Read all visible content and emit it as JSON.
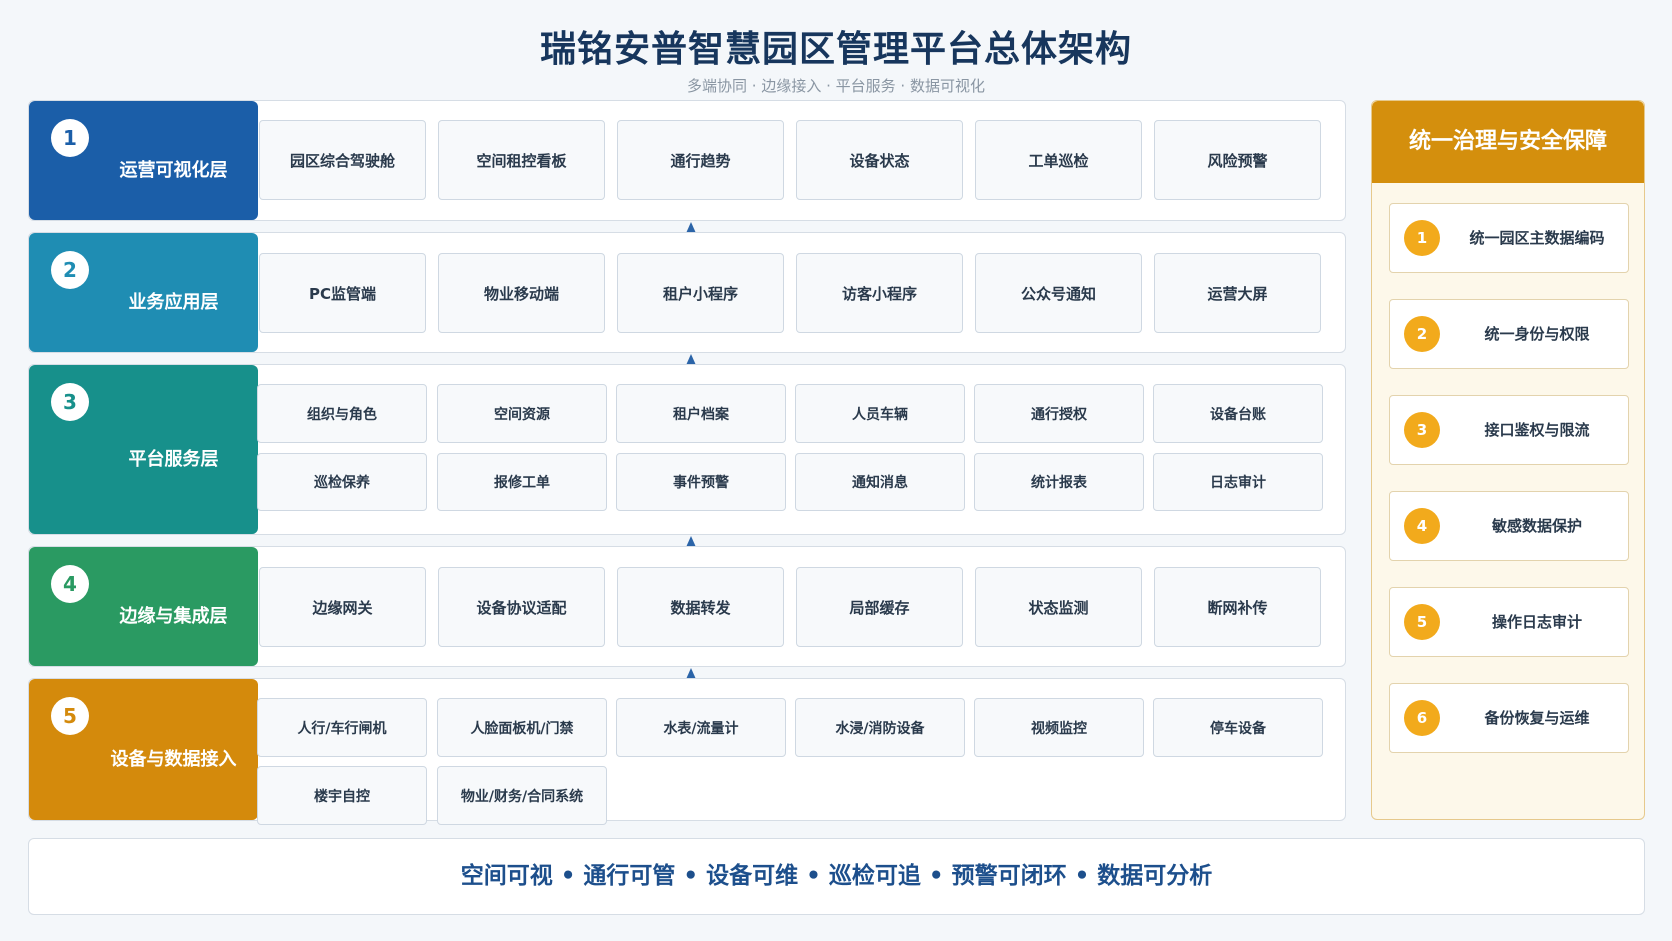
{
  "title": "瑞铭安普智慧园区管理平台总体架构",
  "subtitle": "多端协同 · 边缘接入 · 平台服务 · 数据可视化",
  "layers": [
    {
      "num": "1",
      "name": "运营可视化层",
      "color": "#1b5ea8",
      "modules": [
        "园区综合驾驶舱",
        "空间租控看板",
        "通行趋势",
        "设备状态",
        "工单巡检",
        "风险预警"
      ]
    },
    {
      "num": "2",
      "name": "业务应用层",
      "color": "#1f8db3",
      "modules": [
        "PC监管端",
        "物业移动端",
        "租户小程序",
        "访客小程序",
        "公众号通知",
        "运营大屏"
      ]
    },
    {
      "num": "3",
      "name": "平台服务层",
      "color": "#17908b",
      "modules": [
        "组织与角色",
        "空间资源",
        "租户档案",
        "人员车辆",
        "通行授权",
        "设备台账",
        "巡检保养",
        "报修工单",
        "事件预警",
        "通知消息",
        "统计报表",
        "日志审计"
      ]
    },
    {
      "num": "4",
      "name": "边缘与集成层",
      "color": "#2a9a62",
      "modules": [
        "边缘网关",
        "设备协议适配",
        "数据转发",
        "局部缓存",
        "状态监测",
        "断网补传"
      ]
    },
    {
      "num": "5",
      "name": "设备与数据接入",
      "color": "#d48a0c",
      "modules": [
        "人行/车行闸机",
        "人脸面板机/门禁",
        "水表/流量计",
        "水浸/消防设备",
        "视频监控",
        "停车设备",
        "楼宇自控",
        "物业/财务/合同系统"
      ]
    }
  ],
  "governance": {
    "title": "统一治理与安全保障",
    "items": [
      {
        "num": "1",
        "label": "统一园区主数据编码"
      },
      {
        "num": "2",
        "label": "统一身份与权限"
      },
      {
        "num": "3",
        "label": "接口鉴权与限流"
      },
      {
        "num": "4",
        "label": "敏感数据保护"
      },
      {
        "num": "5",
        "label": "操作日志审计"
      },
      {
        "num": "6",
        "label": "备份恢复与运维"
      }
    ]
  },
  "footer": "空间可视 • 通行可管 • 设备可维 • 巡检可追 • 预警可闭环 • 数据可分析"
}
